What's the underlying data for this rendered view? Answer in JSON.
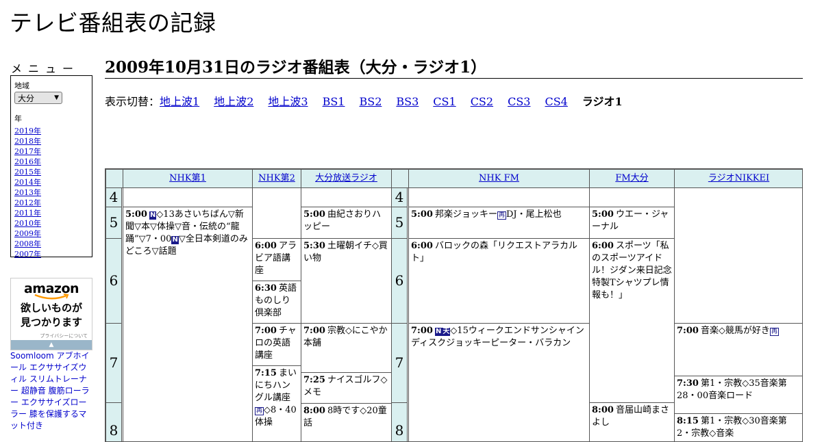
{
  "site_title": "テレビ番組表の記録",
  "menu": {
    "heading": "メニュー",
    "region_label": "地域",
    "region_value": "大分",
    "year_label": "年",
    "years": [
      "2019年",
      "2018年",
      "2017年",
      "2016年",
      "2015年",
      "2014年",
      "2013年",
      "2012年",
      "2011年",
      "2010年",
      "2009年",
      "2008年",
      "2007年"
    ]
  },
  "ad": {
    "brand": "amazon",
    "tagline_1": "欲しいものが",
    "tagline_2": "見つかります",
    "privacy": "プライバシーについて",
    "links": "Soomloom アブホイール エクササイズウィル スリムトレーナー 超静音 腹筋ローラー エクササイズローラー 膝を保護するマット付き"
  },
  "page_title": "2009年10月31日のラジオ番組表（大分・ラジオ1）",
  "switcher": {
    "prefix": "表示切替：",
    "items": [
      "地上波1",
      "地上波2",
      "地上波3",
      "BS1",
      "BS2",
      "BS3",
      "CS1",
      "CS2",
      "CS3",
      "CS4"
    ],
    "current": "ラジオ1"
  },
  "channels": [
    "NHK第1",
    "NHK第2",
    "大分放送ラジオ",
    "NHK FM",
    "FM大分",
    "ラジオNIKKEI"
  ],
  "hours": [
    "4",
    "5",
    "6",
    "7",
    "8"
  ],
  "programs": {
    "nhk1_0500": {
      "time": "5:00",
      "mark": "N",
      "text1": "◇13あさいちばん▽新聞▽本▽体操▽音・伝統の“龍踊”▽7・00",
      "mark2": "N",
      "text2": "▽全日本剣道のみどころ▽話題"
    },
    "nhk2_0600": {
      "time": "6:00",
      "text": "アラビア語講座"
    },
    "nhk2_0630": {
      "time": "6:30",
      "text": "英語ものしり倶楽部"
    },
    "nhk2_0700": {
      "time": "7:00",
      "text": "チャロの英語講座"
    },
    "nhk2_0715": {
      "time": "7:15",
      "text": "まいにちハングル講座",
      "mark": "再",
      "text2": "◇8・40体操"
    },
    "obs_0500": {
      "time": "5:00",
      "text": "由紀さおりハッピー"
    },
    "obs_0530": {
      "time": "5:30",
      "text": "土曜朝イチ◇買い物"
    },
    "obs_0700": {
      "time": "7:00",
      "text": "宗教◇にこやか本舗"
    },
    "obs_0725": {
      "time": "7:25",
      "text": "ナイスゴルフ◇メモ"
    },
    "obs_0800": {
      "time": "8:00",
      "text": "8時です◇20童話"
    },
    "fm_0500": {
      "time": "5:00",
      "text": "邦楽ジョッキー",
      "mark": "再",
      "text2": "DJ・尾上松也"
    },
    "fm_0600": {
      "time": "6:00",
      "text": "バロックの森「リクエストアラカルト」"
    },
    "fm_0700": {
      "time": "7:00",
      "mark": "N",
      "mark2": "天",
      "text": "◇15ウィークエンドサンシャイン ディスクジョッキーピーター・バラカン"
    },
    "fmoita_0500": {
      "time": "5:00",
      "text": "ウエー・ジャーナル"
    },
    "fmoita_0600": {
      "time": "6:00",
      "text": "スポーツ「私のスポーツアイドル！ジダン来日記念特製Tシャツプレ情報も！」"
    },
    "fmoita_0800": {
      "time": "8:00",
      "text": "音届山崎まさよし"
    },
    "nikkei_0700": {
      "time": "7:00",
      "text": "音楽◇競馬が好き",
      "mark": "再"
    },
    "nikkei_0730": {
      "time": "7:30",
      "text": "第1・宗教◇35音楽第28・00音楽ロード"
    },
    "nikkei_0815": {
      "time": "8:15",
      "text": "第1・宗教◇30音楽第2・宗教◇音楽"
    }
  }
}
